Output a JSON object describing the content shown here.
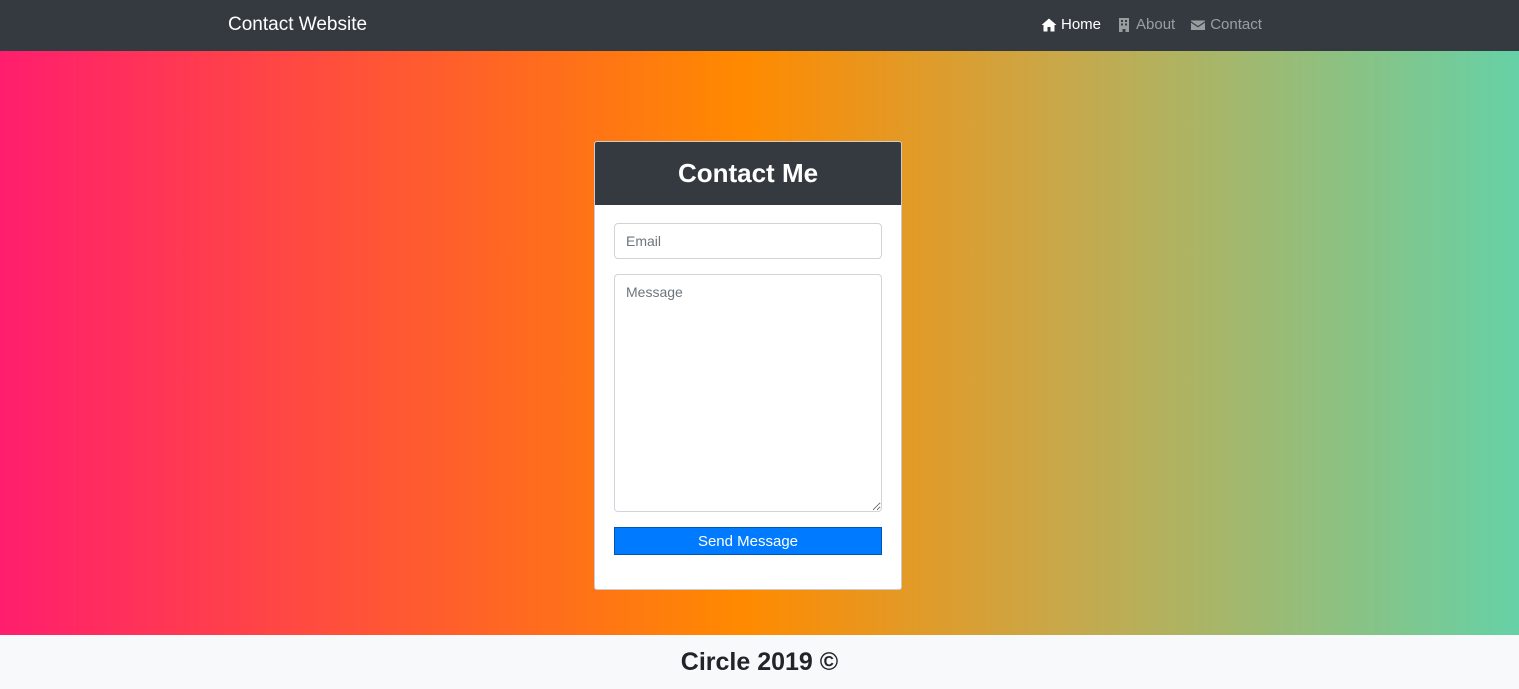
{
  "navbar": {
    "brand": "Contact Website",
    "items": [
      {
        "label": "Home",
        "icon": "home-icon",
        "active": true
      },
      {
        "label": "About",
        "icon": "building-icon",
        "active": false
      },
      {
        "label": "Contact",
        "icon": "envelope-icon",
        "active": false
      }
    ]
  },
  "hero": {
    "gradient_colors": [
      "#ff1e6e",
      "#ff8a00",
      "#66d1a6"
    ]
  },
  "contact_form": {
    "title": "Contact Me",
    "email_placeholder": "Email",
    "message_placeholder": "Message",
    "submit_label": "Send Message"
  },
  "footer": {
    "text": "Circle 2019 ©"
  },
  "colors": {
    "navbar_bg": "#343a40",
    "button_primary": "#007bff",
    "footer_bg": "#f8f9fa"
  }
}
